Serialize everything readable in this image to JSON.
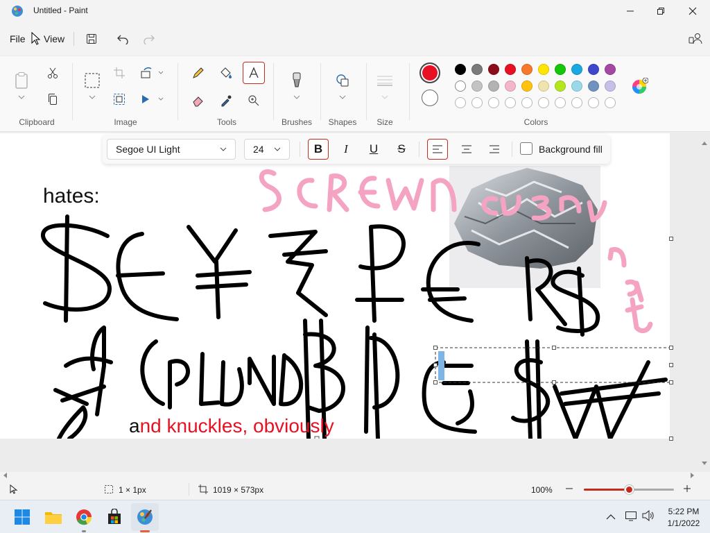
{
  "window": {
    "title": "Untitled - Paint"
  },
  "menu": {
    "file": "File",
    "view": "View"
  },
  "ribbon": {
    "groups": {
      "clipboard": "Clipboard",
      "image": "Image",
      "tools": "Tools",
      "brushes": "Brushes",
      "shapes": "Shapes",
      "size": "Size",
      "colors": "Colors"
    },
    "primary_color": "#e81123",
    "secondary_color": "#ffffff",
    "palette_row1": [
      "#000000",
      "#7a7a7a",
      "#8b0d1b",
      "#e81123",
      "#f7792b",
      "#ffe600",
      "#16c60c",
      "#19a9e0",
      "#3f48cc",
      "#a349a4"
    ],
    "palette_row2": [
      "#ffffff",
      "#c3c3c3",
      "#b3b3b3",
      "#f4b5c9",
      "#ffc20e",
      "#efe4b0",
      "#b5e61d",
      "#99d9ea",
      "#7092be",
      "#c8bfe7"
    ]
  },
  "textbar": {
    "font": "Segoe UI Light",
    "size": "24",
    "background_fill": "Background fill"
  },
  "canvas": {
    "text_hates": "hates:",
    "text_and": "a",
    "text_knuckles": "nd knuckles, obviously",
    "pink_scrawl": "Scrcwn cu3u",
    "pink_side": "n a t e"
  },
  "status": {
    "selection": "1 × 1px",
    "canvas_size": "1019 × 573px",
    "zoom": "100%",
    "zoom_level": 0.5
  },
  "taskbar": {
    "time": "5:22 PM",
    "date": "1/1/2022"
  }
}
